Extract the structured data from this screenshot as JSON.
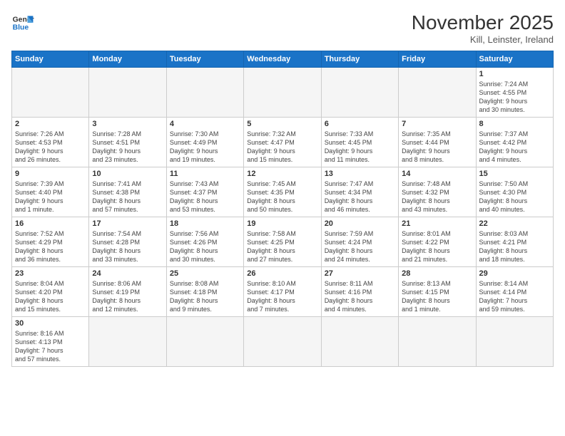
{
  "logo": {
    "line1": "General",
    "line2": "Blue"
  },
  "calendar_title": "November 2025",
  "calendar_subtitle": "Kill, Leinster, Ireland",
  "headers": [
    "Sunday",
    "Monday",
    "Tuesday",
    "Wednesday",
    "Thursday",
    "Friday",
    "Saturday"
  ],
  "weeks": [
    [
      {
        "day": "",
        "info": ""
      },
      {
        "day": "",
        "info": ""
      },
      {
        "day": "",
        "info": ""
      },
      {
        "day": "",
        "info": ""
      },
      {
        "day": "",
        "info": ""
      },
      {
        "day": "",
        "info": ""
      },
      {
        "day": "1",
        "info": "Sunrise: 7:24 AM\nSunset: 4:55 PM\nDaylight: 9 hours\nand 30 minutes."
      }
    ],
    [
      {
        "day": "2",
        "info": "Sunrise: 7:26 AM\nSunset: 4:53 PM\nDaylight: 9 hours\nand 26 minutes."
      },
      {
        "day": "3",
        "info": "Sunrise: 7:28 AM\nSunset: 4:51 PM\nDaylight: 9 hours\nand 23 minutes."
      },
      {
        "day": "4",
        "info": "Sunrise: 7:30 AM\nSunset: 4:49 PM\nDaylight: 9 hours\nand 19 minutes."
      },
      {
        "day": "5",
        "info": "Sunrise: 7:32 AM\nSunset: 4:47 PM\nDaylight: 9 hours\nand 15 minutes."
      },
      {
        "day": "6",
        "info": "Sunrise: 7:33 AM\nSunset: 4:45 PM\nDaylight: 9 hours\nand 11 minutes."
      },
      {
        "day": "7",
        "info": "Sunrise: 7:35 AM\nSunset: 4:44 PM\nDaylight: 9 hours\nand 8 minutes."
      },
      {
        "day": "8",
        "info": "Sunrise: 7:37 AM\nSunset: 4:42 PM\nDaylight: 9 hours\nand 4 minutes."
      }
    ],
    [
      {
        "day": "9",
        "info": "Sunrise: 7:39 AM\nSunset: 4:40 PM\nDaylight: 9 hours\nand 1 minute."
      },
      {
        "day": "10",
        "info": "Sunrise: 7:41 AM\nSunset: 4:38 PM\nDaylight: 8 hours\nand 57 minutes."
      },
      {
        "day": "11",
        "info": "Sunrise: 7:43 AM\nSunset: 4:37 PM\nDaylight: 8 hours\nand 53 minutes."
      },
      {
        "day": "12",
        "info": "Sunrise: 7:45 AM\nSunset: 4:35 PM\nDaylight: 8 hours\nand 50 minutes."
      },
      {
        "day": "13",
        "info": "Sunrise: 7:47 AM\nSunset: 4:34 PM\nDaylight: 8 hours\nand 46 minutes."
      },
      {
        "day": "14",
        "info": "Sunrise: 7:48 AM\nSunset: 4:32 PM\nDaylight: 8 hours\nand 43 minutes."
      },
      {
        "day": "15",
        "info": "Sunrise: 7:50 AM\nSunset: 4:30 PM\nDaylight: 8 hours\nand 40 minutes."
      }
    ],
    [
      {
        "day": "16",
        "info": "Sunrise: 7:52 AM\nSunset: 4:29 PM\nDaylight: 8 hours\nand 36 minutes."
      },
      {
        "day": "17",
        "info": "Sunrise: 7:54 AM\nSunset: 4:28 PM\nDaylight: 8 hours\nand 33 minutes."
      },
      {
        "day": "18",
        "info": "Sunrise: 7:56 AM\nSunset: 4:26 PM\nDaylight: 8 hours\nand 30 minutes."
      },
      {
        "day": "19",
        "info": "Sunrise: 7:58 AM\nSunset: 4:25 PM\nDaylight: 8 hours\nand 27 minutes."
      },
      {
        "day": "20",
        "info": "Sunrise: 7:59 AM\nSunset: 4:24 PM\nDaylight: 8 hours\nand 24 minutes."
      },
      {
        "day": "21",
        "info": "Sunrise: 8:01 AM\nSunset: 4:22 PM\nDaylight: 8 hours\nand 21 minutes."
      },
      {
        "day": "22",
        "info": "Sunrise: 8:03 AM\nSunset: 4:21 PM\nDaylight: 8 hours\nand 18 minutes."
      }
    ],
    [
      {
        "day": "23",
        "info": "Sunrise: 8:04 AM\nSunset: 4:20 PM\nDaylight: 8 hours\nand 15 minutes."
      },
      {
        "day": "24",
        "info": "Sunrise: 8:06 AM\nSunset: 4:19 PM\nDaylight: 8 hours\nand 12 minutes."
      },
      {
        "day": "25",
        "info": "Sunrise: 8:08 AM\nSunset: 4:18 PM\nDaylight: 8 hours\nand 9 minutes."
      },
      {
        "day": "26",
        "info": "Sunrise: 8:10 AM\nSunset: 4:17 PM\nDaylight: 8 hours\nand 7 minutes."
      },
      {
        "day": "27",
        "info": "Sunrise: 8:11 AM\nSunset: 4:16 PM\nDaylight: 8 hours\nand 4 minutes."
      },
      {
        "day": "28",
        "info": "Sunrise: 8:13 AM\nSunset: 4:15 PM\nDaylight: 8 hours\nand 1 minute."
      },
      {
        "day": "29",
        "info": "Sunrise: 8:14 AM\nSunset: 4:14 PM\nDaylight: 7 hours\nand 59 minutes."
      }
    ],
    [
      {
        "day": "30",
        "info": "Sunrise: 8:16 AM\nSunset: 4:13 PM\nDaylight: 7 hours\nand 57 minutes."
      },
      {
        "day": "",
        "info": ""
      },
      {
        "day": "",
        "info": ""
      },
      {
        "day": "",
        "info": ""
      },
      {
        "day": "",
        "info": ""
      },
      {
        "day": "",
        "info": ""
      },
      {
        "day": "",
        "info": ""
      }
    ]
  ]
}
